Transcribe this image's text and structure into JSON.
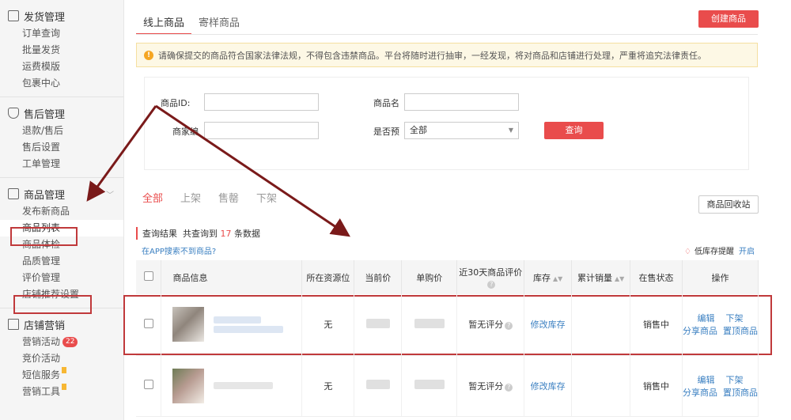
{
  "sidebar": {
    "groups": [
      {
        "title": "发货管理",
        "items": [
          "订单查询",
          "批量发货",
          "运费模版",
          "包裹中心"
        ]
      },
      {
        "title": "售后管理",
        "items": [
          "退款/售后",
          "售后设置",
          "工单管理"
        ]
      },
      {
        "title": "商品管理",
        "items": [
          "发布新商品",
          "商品列表",
          "商品体检",
          "品质管理",
          "评价管理",
          "店铺推荐设置"
        ]
      },
      {
        "title": "店铺营销",
        "items": [
          "营销活动",
          "竞价活动",
          "短信服务",
          "营销工具"
        ],
        "badge": "22"
      }
    ]
  },
  "tabs": [
    "线上商品",
    "寄样商品"
  ],
  "create_button": "创建商品",
  "notice": "请确保提交的商品符合国家法律法规，不得包含违禁商品。平台将随时进行抽审，一经发现，将对商品和店铺进行处理，严重将追究法律责任。",
  "filters": {
    "product_id_label": "商品ID:",
    "product_name_label": "商品名",
    "merchant_code_label": "商家编",
    "presale_label": "是否预",
    "presale_value": "全部",
    "query_button": "查询"
  },
  "status_tabs": [
    "全部",
    "上架",
    "售罄",
    "下架"
  ],
  "recycle_button": "商品回收站",
  "result": {
    "label": "查询结果",
    "prefix": "共查询到",
    "count": "17",
    "suffix": "条数据"
  },
  "app_link": "在APP搜索不到商品?",
  "low_stock": {
    "label": "低库存提醒",
    "toggle": "开启"
  },
  "table": {
    "headers": [
      "商品信息",
      "所在资源位",
      "当前价",
      "单购价",
      "近30天商品评价",
      "库存",
      "累计销量",
      "在售状态",
      "操作"
    ],
    "rows": [
      {
        "resource": "无",
        "rating": "暂无评分",
        "stock_action": "修改库存",
        "status": "销售中",
        "actions": [
          "编辑",
          "下架",
          "分享商品",
          "置顶商品"
        ]
      },
      {
        "resource": "无",
        "rating": "暂无评分",
        "stock_action": "修改库存",
        "status": "销售中",
        "actions": [
          "编辑",
          "下架",
          "分享商品",
          "置顶商品"
        ]
      }
    ]
  }
}
